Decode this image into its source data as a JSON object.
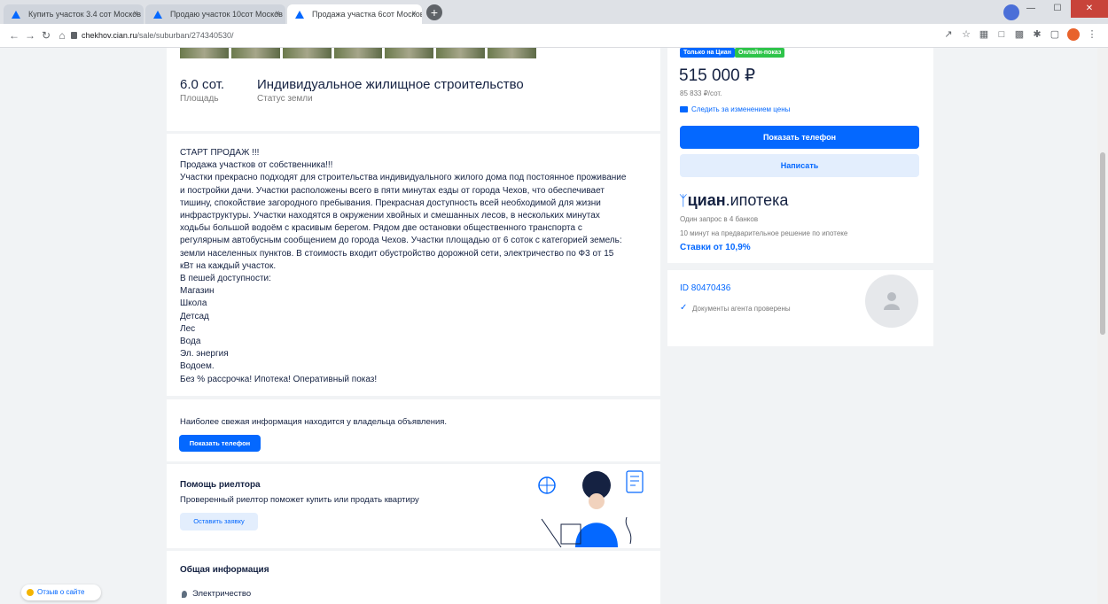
{
  "browser": {
    "tabs": [
      {
        "title": "Купить участок 3.4 сот Москов"
      },
      {
        "title": "Продаю участок 10сот Москов"
      },
      {
        "title": "Продажа участка 6сот Москов"
      }
    ],
    "close_glyph": "×",
    "new_tab_glyph": "+",
    "url_host": "chekhov.cian.ru",
    "url_path": "/sale/suburban/274340530/",
    "window_buttons": [
      "—",
      "☐",
      "✕"
    ]
  },
  "colors": {
    "accent": "#0468ff",
    "accent_light": "#e3eefd",
    "badge_green": "#2ec44a"
  },
  "listing": {
    "area_value": "6.0 сот.",
    "area_label": "Площадь",
    "land_status_value": "Индивидуальное жилищное строительство",
    "land_status_label": "Статус земли",
    "description_lines": [
      "СТАРТ ПРОДАЖ !!!",
      "Продажа участков от собственника!!!",
      "Участки прекрасно подходят для строительства индивидуального жилого дома под постоянное проживание",
      "и постройки дачи. Участки расположены всего в пяти минутах езды от города Чехов, что обеспечивает",
      "тишину, спокойствие загородного пребывания. Прекрасная доступность всей необходимой для жизни",
      "инфраструктуры. Участки находятся в окружении хвойных и смешанных лесов, в нескольких минутах",
      "ходьбы большой водоём с красивым берегом. Рядом две остановки общественного транспорта с",
      "регулярным автобусным сообщением до города Чехов. Участки площадью от 6 соток с категорией земель:",
      "земли населенных пунктов. В стоимость входит обустройство дорожной сети, электричество по Ф3 от 15",
      "кВт на каждый участок.",
      "В пешей доступности:",
      "Магазин",
      "Школа",
      "Детсад",
      "Лес",
      "Вода",
      "Эл. энергия",
      "Водоем.",
      "Без % рассрочка! Ипотека! Оперативный показ!"
    ],
    "owner_info": "Наиболее свежая информация находится у владельца объявления.",
    "show_phone_small": "Показать телефон",
    "realtor_title": "Помощь риелтора",
    "realtor_text": "Проверенный риелтор поможет купить или продать квартиру",
    "realtor_button": "Оставить заявку",
    "general_title": "Общая информация",
    "general_first_item": "Электричество"
  },
  "sidebar": {
    "badge_cian": "Только на Циан",
    "badge_online": "Онлайн-показ",
    "price": "515 000 ₽",
    "price_per": "85 833 ₽/сот.",
    "watch_price": "Следить за изменением цены",
    "show_phone": "Показать телефон",
    "write": "Написать",
    "mortgage_brand_bold": "циан",
    "mortgage_brand_rest": ".ипотека",
    "mortgage_line1": "Один запрос в 4 банков",
    "mortgage_line2": "10 минут на предварительное решение по ипотеке",
    "mortgage_rate": "Ставки от 10,9%",
    "agent_id": "ID 80470436",
    "agent_verified": "Документы агента проверены"
  },
  "feedback": "Отзыв о сайте"
}
